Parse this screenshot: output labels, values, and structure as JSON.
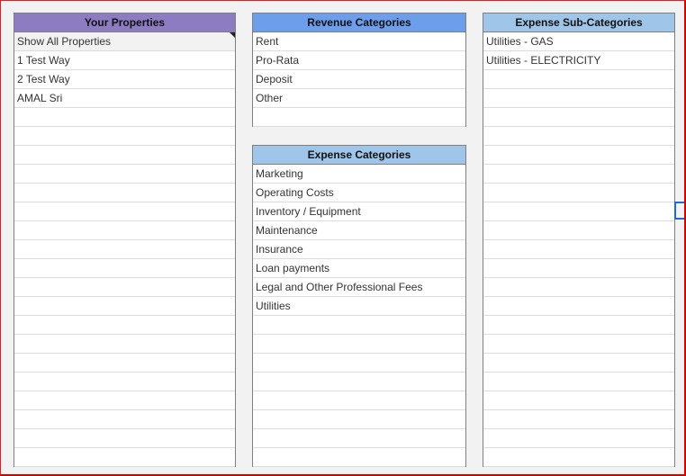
{
  "properties": {
    "header": "Your Properties",
    "header_color": "#8e7cc3",
    "items": [
      "Show All Properties",
      "1 Test Way",
      "2 Test Way",
      "AMAL Sri"
    ]
  },
  "revenue": {
    "header": "Revenue Categories",
    "header_color": "#6d9eeb",
    "items": [
      "Rent",
      "Pro-Rata",
      "Deposit",
      "Other"
    ]
  },
  "expense": {
    "header": "Expense Categories",
    "header_color": "#9fc5e8",
    "items": [
      "Marketing",
      "Operating Costs",
      "Inventory / Equipment",
      "Maintenance",
      "Insurance",
      "Loan payments",
      "Legal and Other Professional Fees",
      "Utilities"
    ]
  },
  "subcategories": {
    "header": "Expense Sub-Categories",
    "header_color": "#9fc5e8",
    "items": [
      "Utilities - GAS",
      "Utilities - ELECTRICITY"
    ]
  }
}
